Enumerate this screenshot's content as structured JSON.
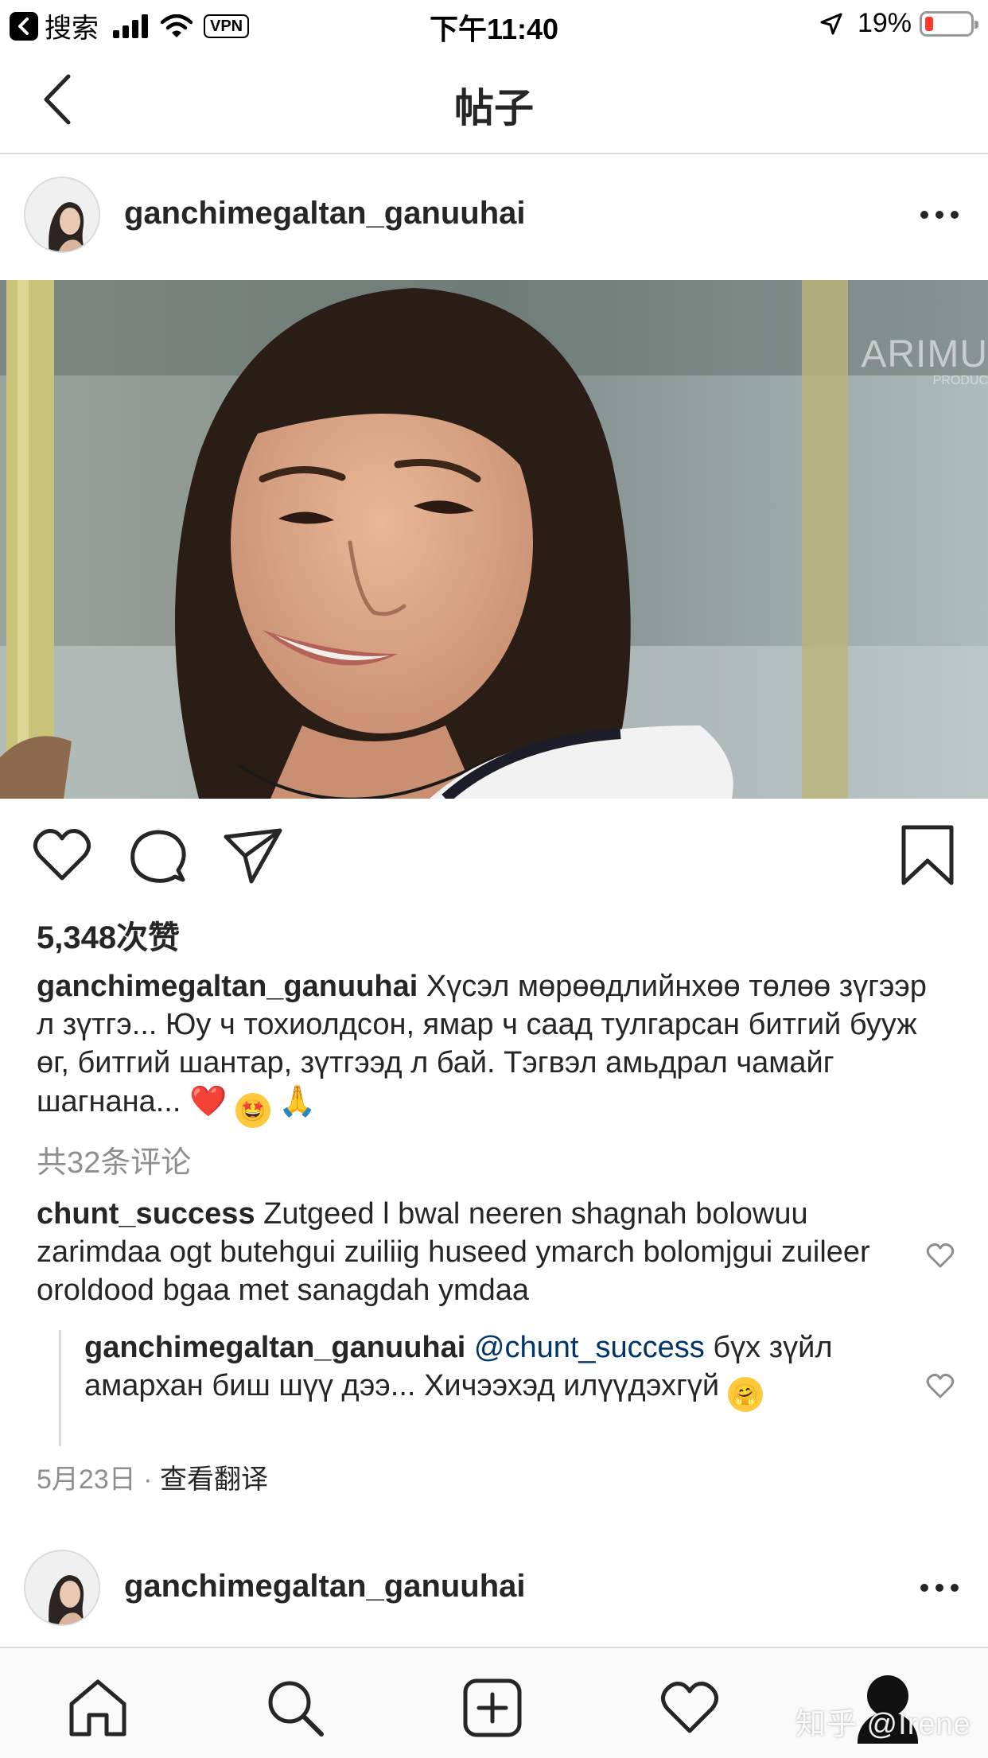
{
  "status_bar": {
    "back_app": "搜索",
    "vpn": "VPN",
    "time": "下午11:40",
    "battery_percent": "19%",
    "battery_level": 0.19,
    "battery_color": "#ff3b30"
  },
  "nav": {
    "title": "帖子",
    "back_icon": "chevron-left-icon"
  },
  "post": {
    "username": "ganchimegaltan_ganuuhai",
    "photo_watermark": "ARIMU",
    "photo_watermark_sub": "PRODUC",
    "likes": "5,348次赞",
    "caption": {
      "username": "ganchimegaltan_ganuuhai",
      "text": " Хүсэл мөрөөдлийнхөө төлөө зүгээр л зүтгэ... Юу ч тохиолдсон, ямар ч саад тулгарсан битгий бууж өг, битгий шантар, зүтгээд л бай. Тэгвэл амьдрал чамайг шагнана... ",
      "emoji_heart": "❤️",
      "emoji_starstruck": "🤩",
      "emoji_pray": "🙏"
    },
    "view_all_comments": "共32条评论",
    "comments": [
      {
        "username": "chunt_success",
        "text": " Zutgeed l bwal neeren shagnah bolowuu zarimdaa ogt butehgui zuiliig huseed ymarch bolomjgui zuileer oroldood bgaa met sanagdah ymdaa"
      }
    ],
    "reply": {
      "username": "ganchimegaltan_ganuuhai",
      "mention": "@chunt_success",
      "text": " бүх зүйл амархан биш шүү дээ... Хичээхэд илүүдэхгүй ",
      "emoji_hug": "🤗"
    },
    "date": "5月23日",
    "separator": " · ",
    "translate": "查看翻译"
  },
  "next_post": {
    "username": "ganchimegaltan_ganuuhai"
  },
  "tab_bar": {
    "items": [
      "home-icon",
      "search-icon",
      "add-post-icon",
      "activity-heart-icon",
      "profile-icon"
    ]
  },
  "site_watermark": "知乎 @Irene"
}
